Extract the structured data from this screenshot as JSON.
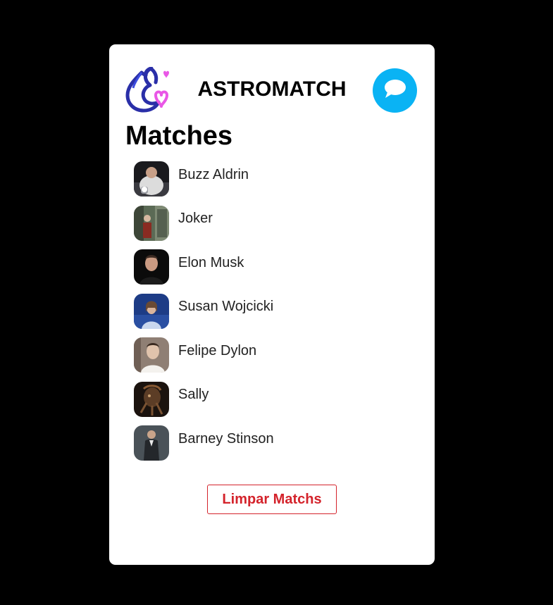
{
  "header": {
    "title": "ASTROMATCH",
    "logo_icon": "flame-heart-logo-icon",
    "chat_icon": "chat-bubble-icon",
    "chat_button_color": "#0ab3f4"
  },
  "main": {
    "section_title": "Matches",
    "matches": [
      {
        "name": "Buzz Aldrin",
        "avatar": "astronaut-photo"
      },
      {
        "name": "Joker",
        "avatar": "joker-photo"
      },
      {
        "name": "Elon Musk",
        "avatar": "elon-photo"
      },
      {
        "name": "Susan Wojcicki",
        "avatar": "susan-photo"
      },
      {
        "name": "Felipe Dylon",
        "avatar": "felipe-photo"
      },
      {
        "name": "Sally",
        "avatar": "sally-photo"
      },
      {
        "name": "Barney Stinson",
        "avatar": "barney-photo"
      }
    ],
    "clear_button_label": "Limpar Matchs",
    "clear_button_color": "#d4232b"
  }
}
